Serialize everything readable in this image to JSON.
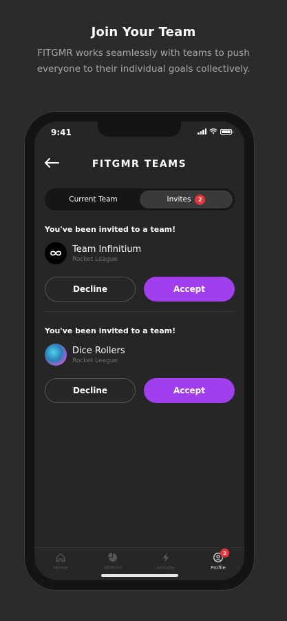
{
  "promo": {
    "title": "Join Your Team",
    "subtitle": "FITGMR works seamlessly with teams to push everyone to their individual goals collectively."
  },
  "status_bar": {
    "time": "9:41"
  },
  "header": {
    "title": "FITGMR TEAMS",
    "back_icon": "arrow-left-icon"
  },
  "segments": {
    "current_team": "Current Team",
    "invites": "Invites",
    "invites_count": "2"
  },
  "invites": [
    {
      "message": "You've been invited to a team!",
      "team_name": "Team Infinitium",
      "game": "Rocket League",
      "decline": "Decline",
      "accept": "Accept"
    },
    {
      "message": "You've been invited to a team!",
      "team_name": "Dice Rollers",
      "game": "Rocket League",
      "decline": "Decline",
      "accept": "Accept"
    }
  ],
  "tabbar": {
    "items": [
      {
        "label": "Home",
        "icon": "home-icon"
      },
      {
        "label": "Metrics",
        "icon": "pie-chart-icon"
      },
      {
        "label": "Activity",
        "icon": "lightning-icon"
      },
      {
        "label": "Profile",
        "icon": "user-icon",
        "badge": "2"
      }
    ]
  },
  "colors": {
    "accent": "#a13ef0",
    "badge": "#e8353a",
    "background": "#2b2b2b"
  }
}
